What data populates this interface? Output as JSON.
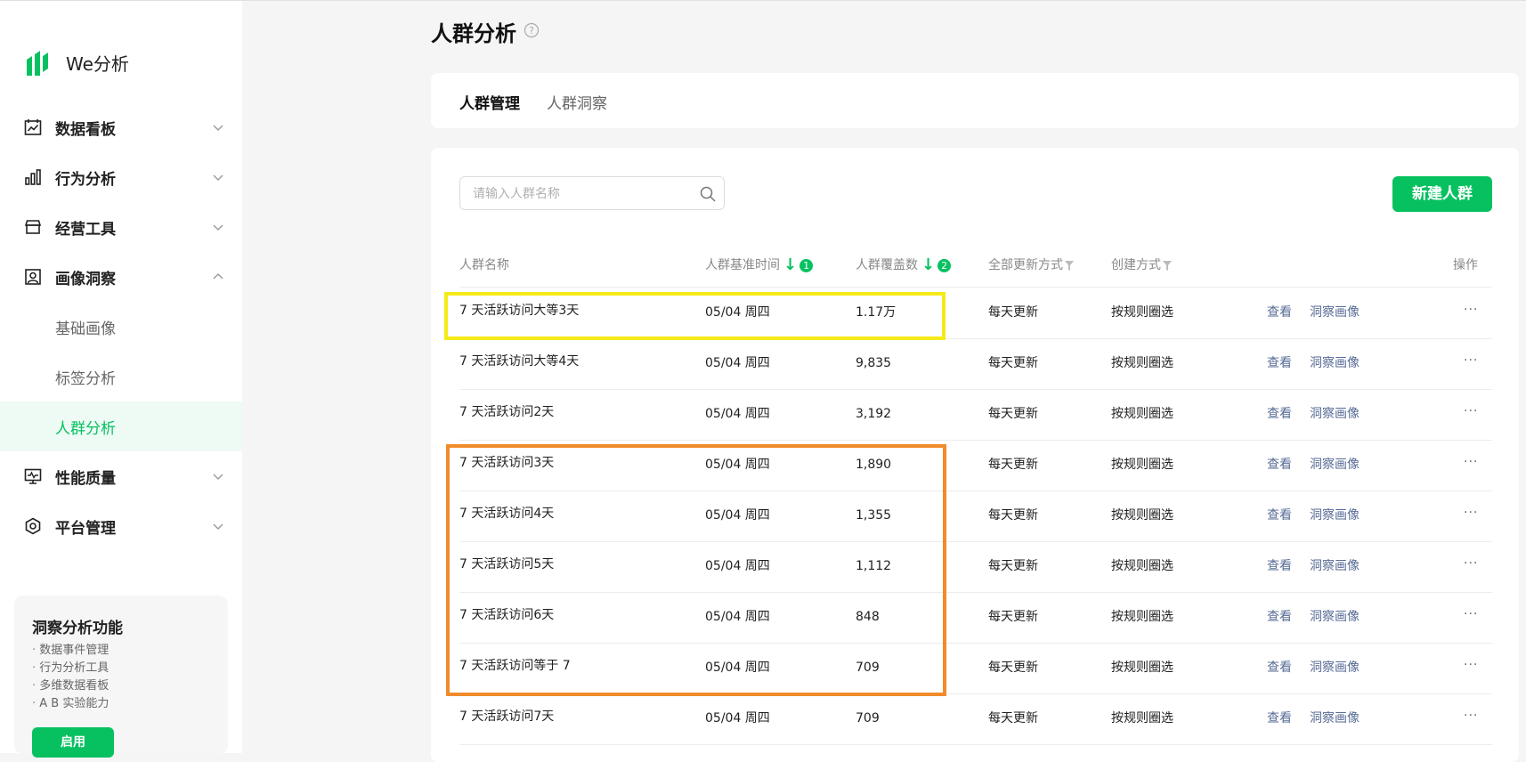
{
  "app": {
    "name": "We分析",
    "accent": "#07c160"
  },
  "sidebar": {
    "items": [
      {
        "label": "数据看板",
        "icon": "dashboard-icon",
        "expanded": false
      },
      {
        "label": "行为分析",
        "icon": "bar-chart-icon",
        "expanded": false
      },
      {
        "label": "经营工具",
        "icon": "store-icon",
        "expanded": false
      },
      {
        "label": "画像洞察",
        "icon": "portrait-icon",
        "expanded": true,
        "children": [
          {
            "label": "基础画像",
            "active": false
          },
          {
            "label": "标签分析",
            "active": false
          },
          {
            "label": "人群分析",
            "active": true
          }
        ]
      },
      {
        "label": "性能质量",
        "icon": "monitor-icon",
        "expanded": false
      },
      {
        "label": "平台管理",
        "icon": "settings-hex-icon",
        "expanded": false
      }
    ],
    "promo": {
      "title": "洞察分析功能",
      "features": [
        "数据事件管理",
        "行为分析工具",
        "多维数据看板",
        "A B 实验能力"
      ],
      "button": "启用"
    }
  },
  "page": {
    "title": "人群分析"
  },
  "tabs": [
    "人群管理",
    "人群洞察"
  ],
  "search": {
    "placeholder": "请输入人群名称"
  },
  "new_button": "新建人群",
  "table": {
    "headers": {
      "name": "人群名称",
      "time": "人群基准时间",
      "time_sort_order": "1",
      "count": "人群覆盖数",
      "count_sort_order": "2",
      "update": "全部更新方式",
      "create": "创建方式",
      "action": "操作"
    },
    "actions": {
      "view": "查看",
      "insight": "洞察画像",
      "more": "···"
    },
    "rows": [
      {
        "name": "7 天活跃访问大等3天",
        "time": "05/04 周四",
        "count": "1.17万",
        "update": "每天更新",
        "create": "按规则圈选"
      },
      {
        "name": "7 天活跃访问大等4天",
        "time": "05/04 周四",
        "count": "9,835",
        "update": "每天更新",
        "create": "按规则圈选"
      },
      {
        "name": "7 天活跃访问2天",
        "time": "05/04 周四",
        "count": "3,192",
        "update": "每天更新",
        "create": "按规则圈选"
      },
      {
        "name": "7 天活跃访问3天",
        "time": "05/04 周四",
        "count": "1,890",
        "update": "每天更新",
        "create": "按规则圈选"
      },
      {
        "name": "7 天活跃访问4天",
        "time": "05/04 周四",
        "count": "1,355",
        "update": "每天更新",
        "create": "按规则圈选"
      },
      {
        "name": "7 天活跃访问5天",
        "time": "05/04 周四",
        "count": "1,112",
        "update": "每天更新",
        "create": "按规则圈选"
      },
      {
        "name": "7 天活跃访问6天",
        "time": "05/04 周四",
        "count": "848",
        "update": "每天更新",
        "create": "按规则圈选"
      },
      {
        "name": "7 天活跃访问等于 7",
        "time": "05/04 周四",
        "count": "709",
        "update": "每天更新",
        "create": "按规则圈选"
      },
      {
        "name": "7 天活跃访问7天",
        "time": "05/04 周四",
        "count": "709",
        "update": "每天更新",
        "create": "按规则圈选"
      }
    ]
  },
  "highlights": {
    "yellow": "#f5ea17",
    "orange": "#f18b2b"
  }
}
